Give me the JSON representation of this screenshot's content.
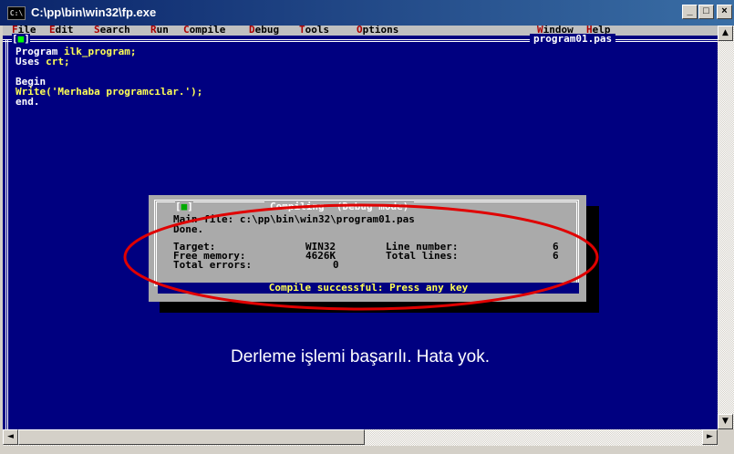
{
  "window": {
    "title": "C:\\pp\\bin\\win32\\fp.exe",
    "icon_text": "C:\\",
    "min_glyph": "_",
    "max_glyph": "□",
    "close_glyph": "×"
  },
  "menu": [
    {
      "hotkey": "F",
      "rest": "ile"
    },
    {
      "hotkey": "E",
      "rest": "dit"
    },
    {
      "hotkey": "S",
      "rest": "earch"
    },
    {
      "hotkey": "R",
      "rest": "un"
    },
    {
      "hotkey": "C",
      "rest": "ompile"
    },
    {
      "hotkey": "D",
      "rest": "ebug"
    },
    {
      "hotkey": "T",
      "rest": "ools"
    },
    {
      "hotkey": "O",
      "rest": "ptions"
    },
    {
      "hotkey": "W",
      "rest": "indow"
    },
    {
      "hotkey": "H",
      "rest": "elp"
    }
  ],
  "editor": {
    "close_left": "[",
    "close_mark": "■",
    "close_right": "]",
    "file_name": "program01.pas",
    "code": {
      "l1_kw": "Program ",
      "l1_id": "ilk_program;",
      "l2_kw": "Uses ",
      "l2_id": "crt;",
      "l4": "Begin",
      "l5_kw": "Write",
      "l5_rest": "('Merhaba programcılar.');",
      "l6": "end."
    }
  },
  "dialog": {
    "close_left": "[",
    "close_mark": "■",
    "close_right": "]",
    "title": "Compiling  (Debug mode)",
    "main_file_label": "Main file: c:\\pp\\bin\\win32\\program01.pas",
    "done": "Done.",
    "target_label": "Target:",
    "target_value": "WIN32",
    "line_number_label": "Line number:",
    "line_number_value": "6",
    "free_memory_label": "Free memory:",
    "free_memory_value": "4626K",
    "total_lines_label": "Total lines:",
    "total_lines_value": "6",
    "total_errors_label": "Total errors:",
    "total_errors_value": "0",
    "status": "Compile successful: Press any key"
  },
  "caption": "Derleme işlemi başarılı. Hata yok.",
  "scrollbars": {
    "up_arrow": "▲",
    "down_arrow": "▼",
    "left_arrow": "◄",
    "right_arrow": "►"
  },
  "colors": {
    "console_bg": "#000080",
    "dialog_bg": "#aaaaaa",
    "annotation": "#e00000"
  }
}
